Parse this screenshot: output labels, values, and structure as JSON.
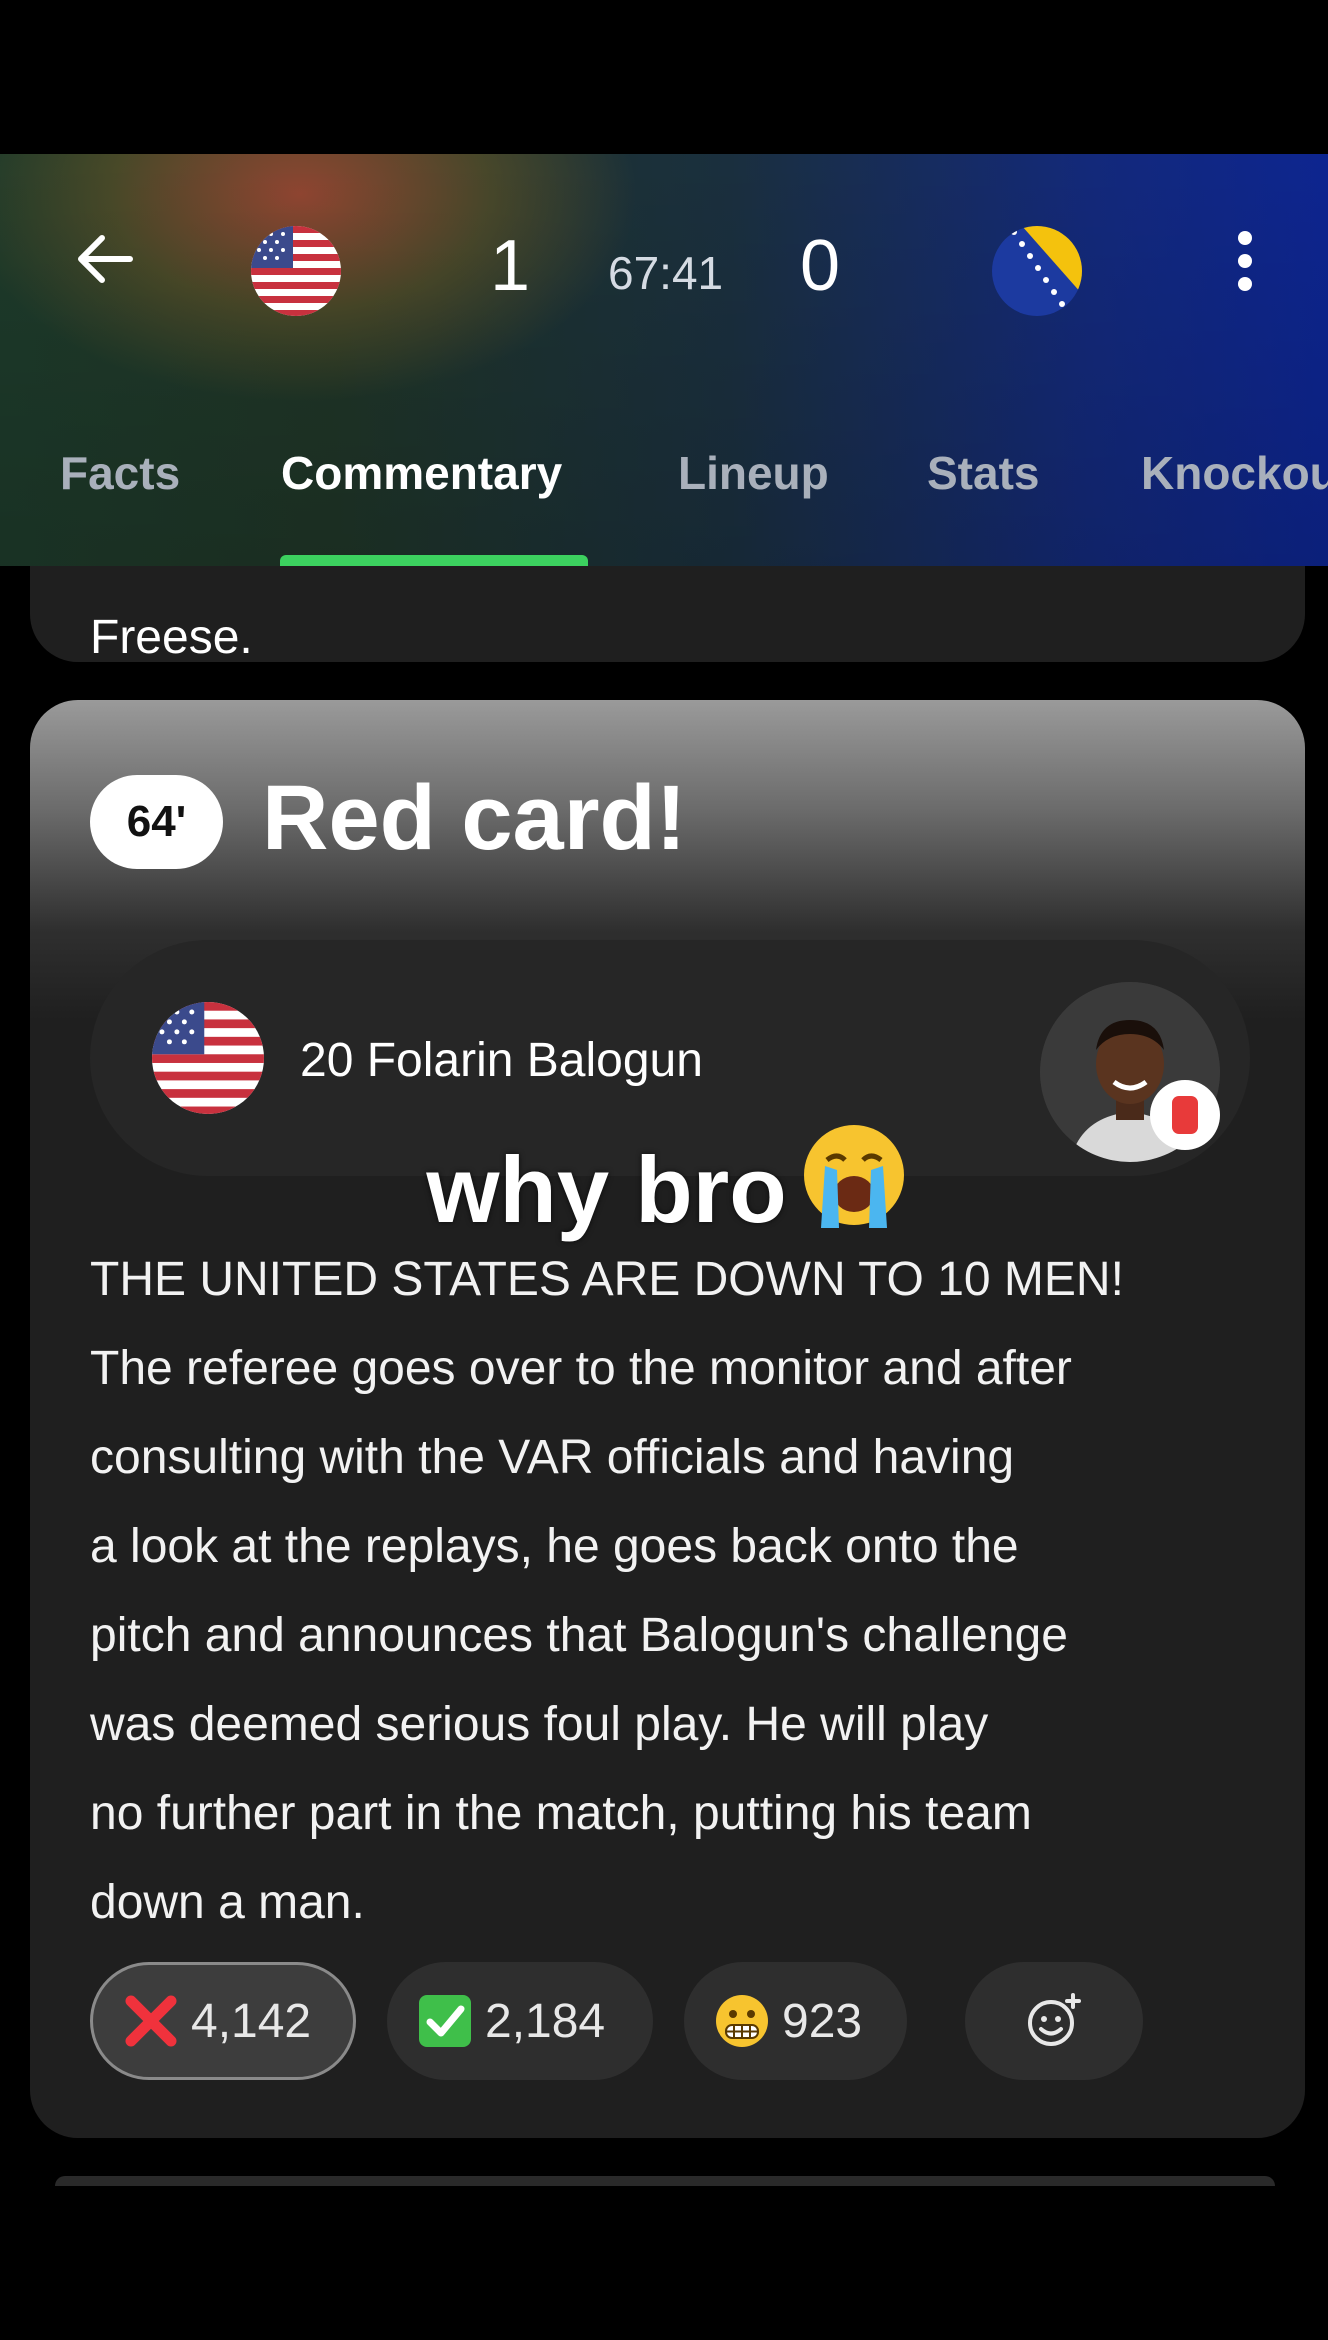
{
  "header": {
    "home_score": "1",
    "clock": "67:41",
    "away_score": "0",
    "home_flag": "us-flag-icon",
    "away_flag": "bosnia-flag-icon",
    "tabs": [
      {
        "label": "Facts"
      },
      {
        "label": "Commentary",
        "active": true
      },
      {
        "label": "Lineup"
      },
      {
        "label": "Stats"
      },
      {
        "label": "Knockout"
      }
    ],
    "accent_color": "#3cd15f"
  },
  "previous_item": {
    "text_fragment": "Freese."
  },
  "event": {
    "minute": "64'",
    "title": "Red card!",
    "player": "20 Folarin Balogun",
    "player_team_flag": "us-flag-icon",
    "card_color": "#e83a3a",
    "overlay_caption": "why bro",
    "overlay_emoji": "loudly-crying-face",
    "commentary_lines": [
      "THE UNITED STATES ARE DOWN TO 10 MEN!",
      "The referee goes over to the monitor and after",
      "consulting with the VAR officials and having",
      "a look at the replays, he goes back onto the",
      "pitch and announces that Balogun's challenge",
      "was deemed serious foul play. He will play",
      "no further part in the match, putting his team",
      "down a man."
    ],
    "reactions": [
      {
        "icon": "cross-mark-icon",
        "count": "4,142",
        "selected": true
      },
      {
        "icon": "check-mark-icon",
        "count": "2,184"
      },
      {
        "icon": "grimacing-face-icon",
        "count": "923"
      },
      {
        "icon": "add-reaction-icon",
        "count": ""
      }
    ]
  }
}
